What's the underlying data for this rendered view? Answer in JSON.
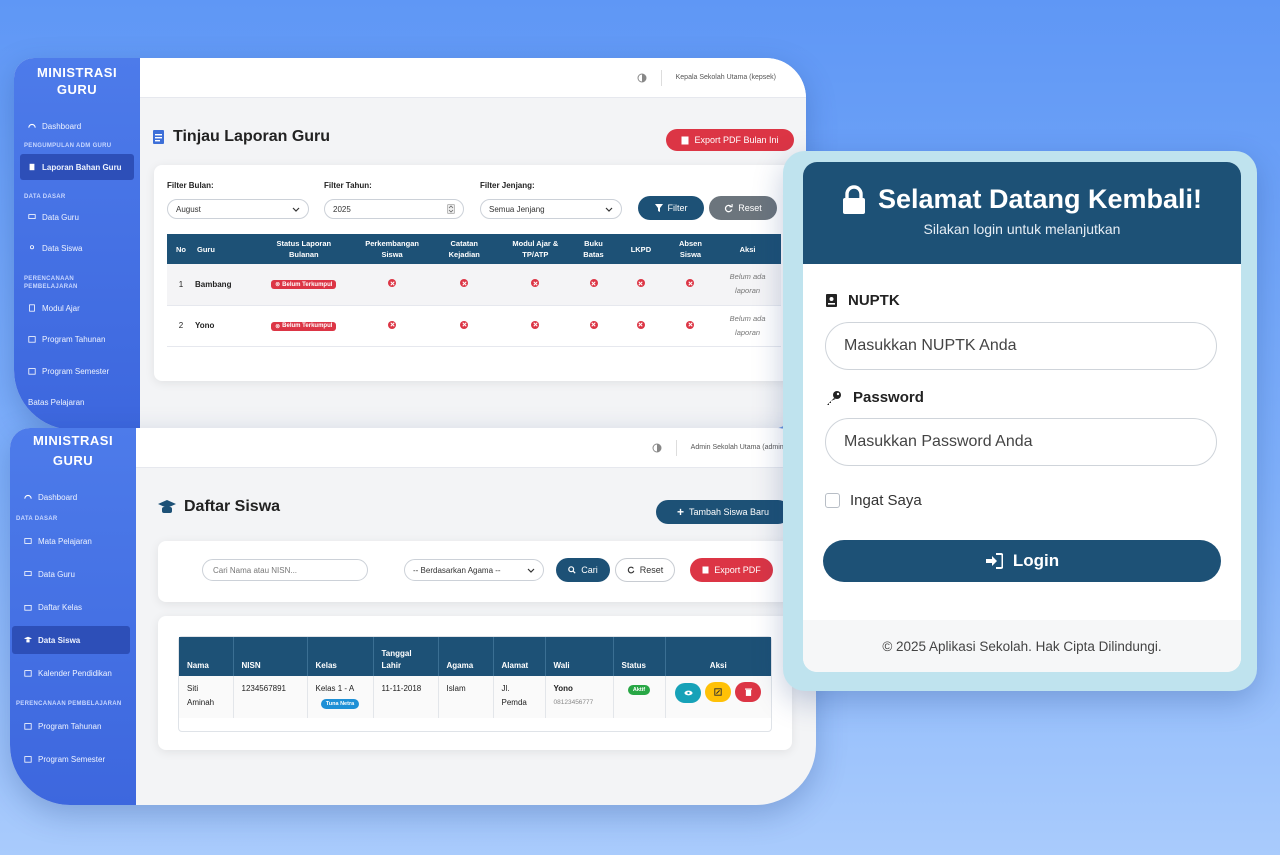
{
  "panel1": {
    "brand": [
      "MINISTRASI",
      "GURU"
    ],
    "sidebar": {
      "items": [
        {
          "label": "Dashboard"
        },
        {
          "label": "Laporan Bahan Guru"
        },
        {
          "label": "Data Guru"
        },
        {
          "label": "Data Siswa"
        },
        {
          "label": "Modul Ajar"
        },
        {
          "label": "Program Tahunan"
        },
        {
          "label": "Program Semester"
        },
        {
          "label": "Batas Pelajaran"
        }
      ],
      "sections": [
        "PENGUMPULAN ADM GURU",
        "DATA DASAR",
        "PERENCANAAN",
        "PEMBELAJARAN"
      ]
    },
    "topbar": {
      "user": "Kepala Sekolah Utama (kepsek)"
    },
    "title": "Tinjau Laporan Guru",
    "export_label": "Export PDF Bulan Ini",
    "filters": {
      "bulan_label": "Filter Bulan:",
      "bulan_value": "August",
      "tahun_label": "Filter Tahun:",
      "tahun_value": "2025",
      "jenjang_label": "Filter Jenjang:",
      "jenjang_value": "Semua Jenjang",
      "filter_btn": "Filter",
      "reset_btn": "Reset"
    },
    "table": {
      "headers": [
        "No",
        "Guru",
        "Status Laporan Bulanan",
        "Perkembangan Siswa",
        "Catatan Kejadian",
        "Modul Ajar & TP/ATP",
        "Buku Batas",
        "LKPD",
        "Absen Siswa",
        "Aksi"
      ],
      "rows": [
        {
          "no": "1",
          "guru": "Bambang",
          "status": "Belum Terkumpul",
          "aksi": "Belum ada laporan"
        },
        {
          "no": "2",
          "guru": "Yono",
          "status": "Belum Terkumpul",
          "aksi": "Belum ada laporan"
        }
      ]
    }
  },
  "panel2": {
    "brand": [
      "MINISTRASI",
      "GURU"
    ],
    "sidebar": {
      "items": [
        {
          "label": "Dashboard"
        },
        {
          "label": "Mata Pelajaran"
        },
        {
          "label": "Data Guru"
        },
        {
          "label": "Daftar Kelas"
        },
        {
          "label": "Data Siswa"
        },
        {
          "label": "Kalender Pendidikan"
        },
        {
          "label": "Program Tahunan"
        },
        {
          "label": "Program Semester"
        }
      ],
      "sections": [
        "DATA DASAR",
        "PERENCANAAN PEMBELAJARAN"
      ]
    },
    "topbar": {
      "user": "Admin Sekolah Utama (admin)"
    },
    "title": "Daftar Siswa",
    "add_label": "Tambah Siswa Baru",
    "search_placeholder": "Cari Nama atau NISN...",
    "agama_select": "-- Berdasarkan Agama --",
    "cari_btn": "Cari",
    "reset_btn": "Reset",
    "export_btn": "Export PDF",
    "table": {
      "headers": [
        "Nama",
        "NISN",
        "Kelas",
        "Tanggal Lahir",
        "Agama",
        "Alamat",
        "Wali",
        "Status",
        "Aksi"
      ],
      "row": {
        "nama": "Siti Aminah",
        "nisn": "1234567891",
        "kelas": "Kelas 1 - A",
        "kelas_badge": "Tuna Netra",
        "tanggal": "11-11-2018",
        "agama": "Islam",
        "alamat": "Jl. Pemda",
        "wali": "Yono",
        "wali_phone": "08123456777",
        "status": "Aktif"
      }
    }
  },
  "login": {
    "title": "Selamat Datang Kembali!",
    "subtitle": "Silakan login untuk melanjutkan",
    "nuptk_label": "NUPTK",
    "nuptk_placeholder": "Masukkan NUPTK Anda",
    "password_label": "Password",
    "password_placeholder": "Masukkan Password Anda",
    "remember_label": "Ingat Saya",
    "login_btn": "Login",
    "footer": "© 2025 Aplikasi Sekolah. Hak Cipta Dilindungi."
  },
  "colors": {
    "navy": "#1d5176",
    "red": "#dc3545",
    "sidebar": "#4d7bea",
    "background": "#6ea2f8"
  }
}
